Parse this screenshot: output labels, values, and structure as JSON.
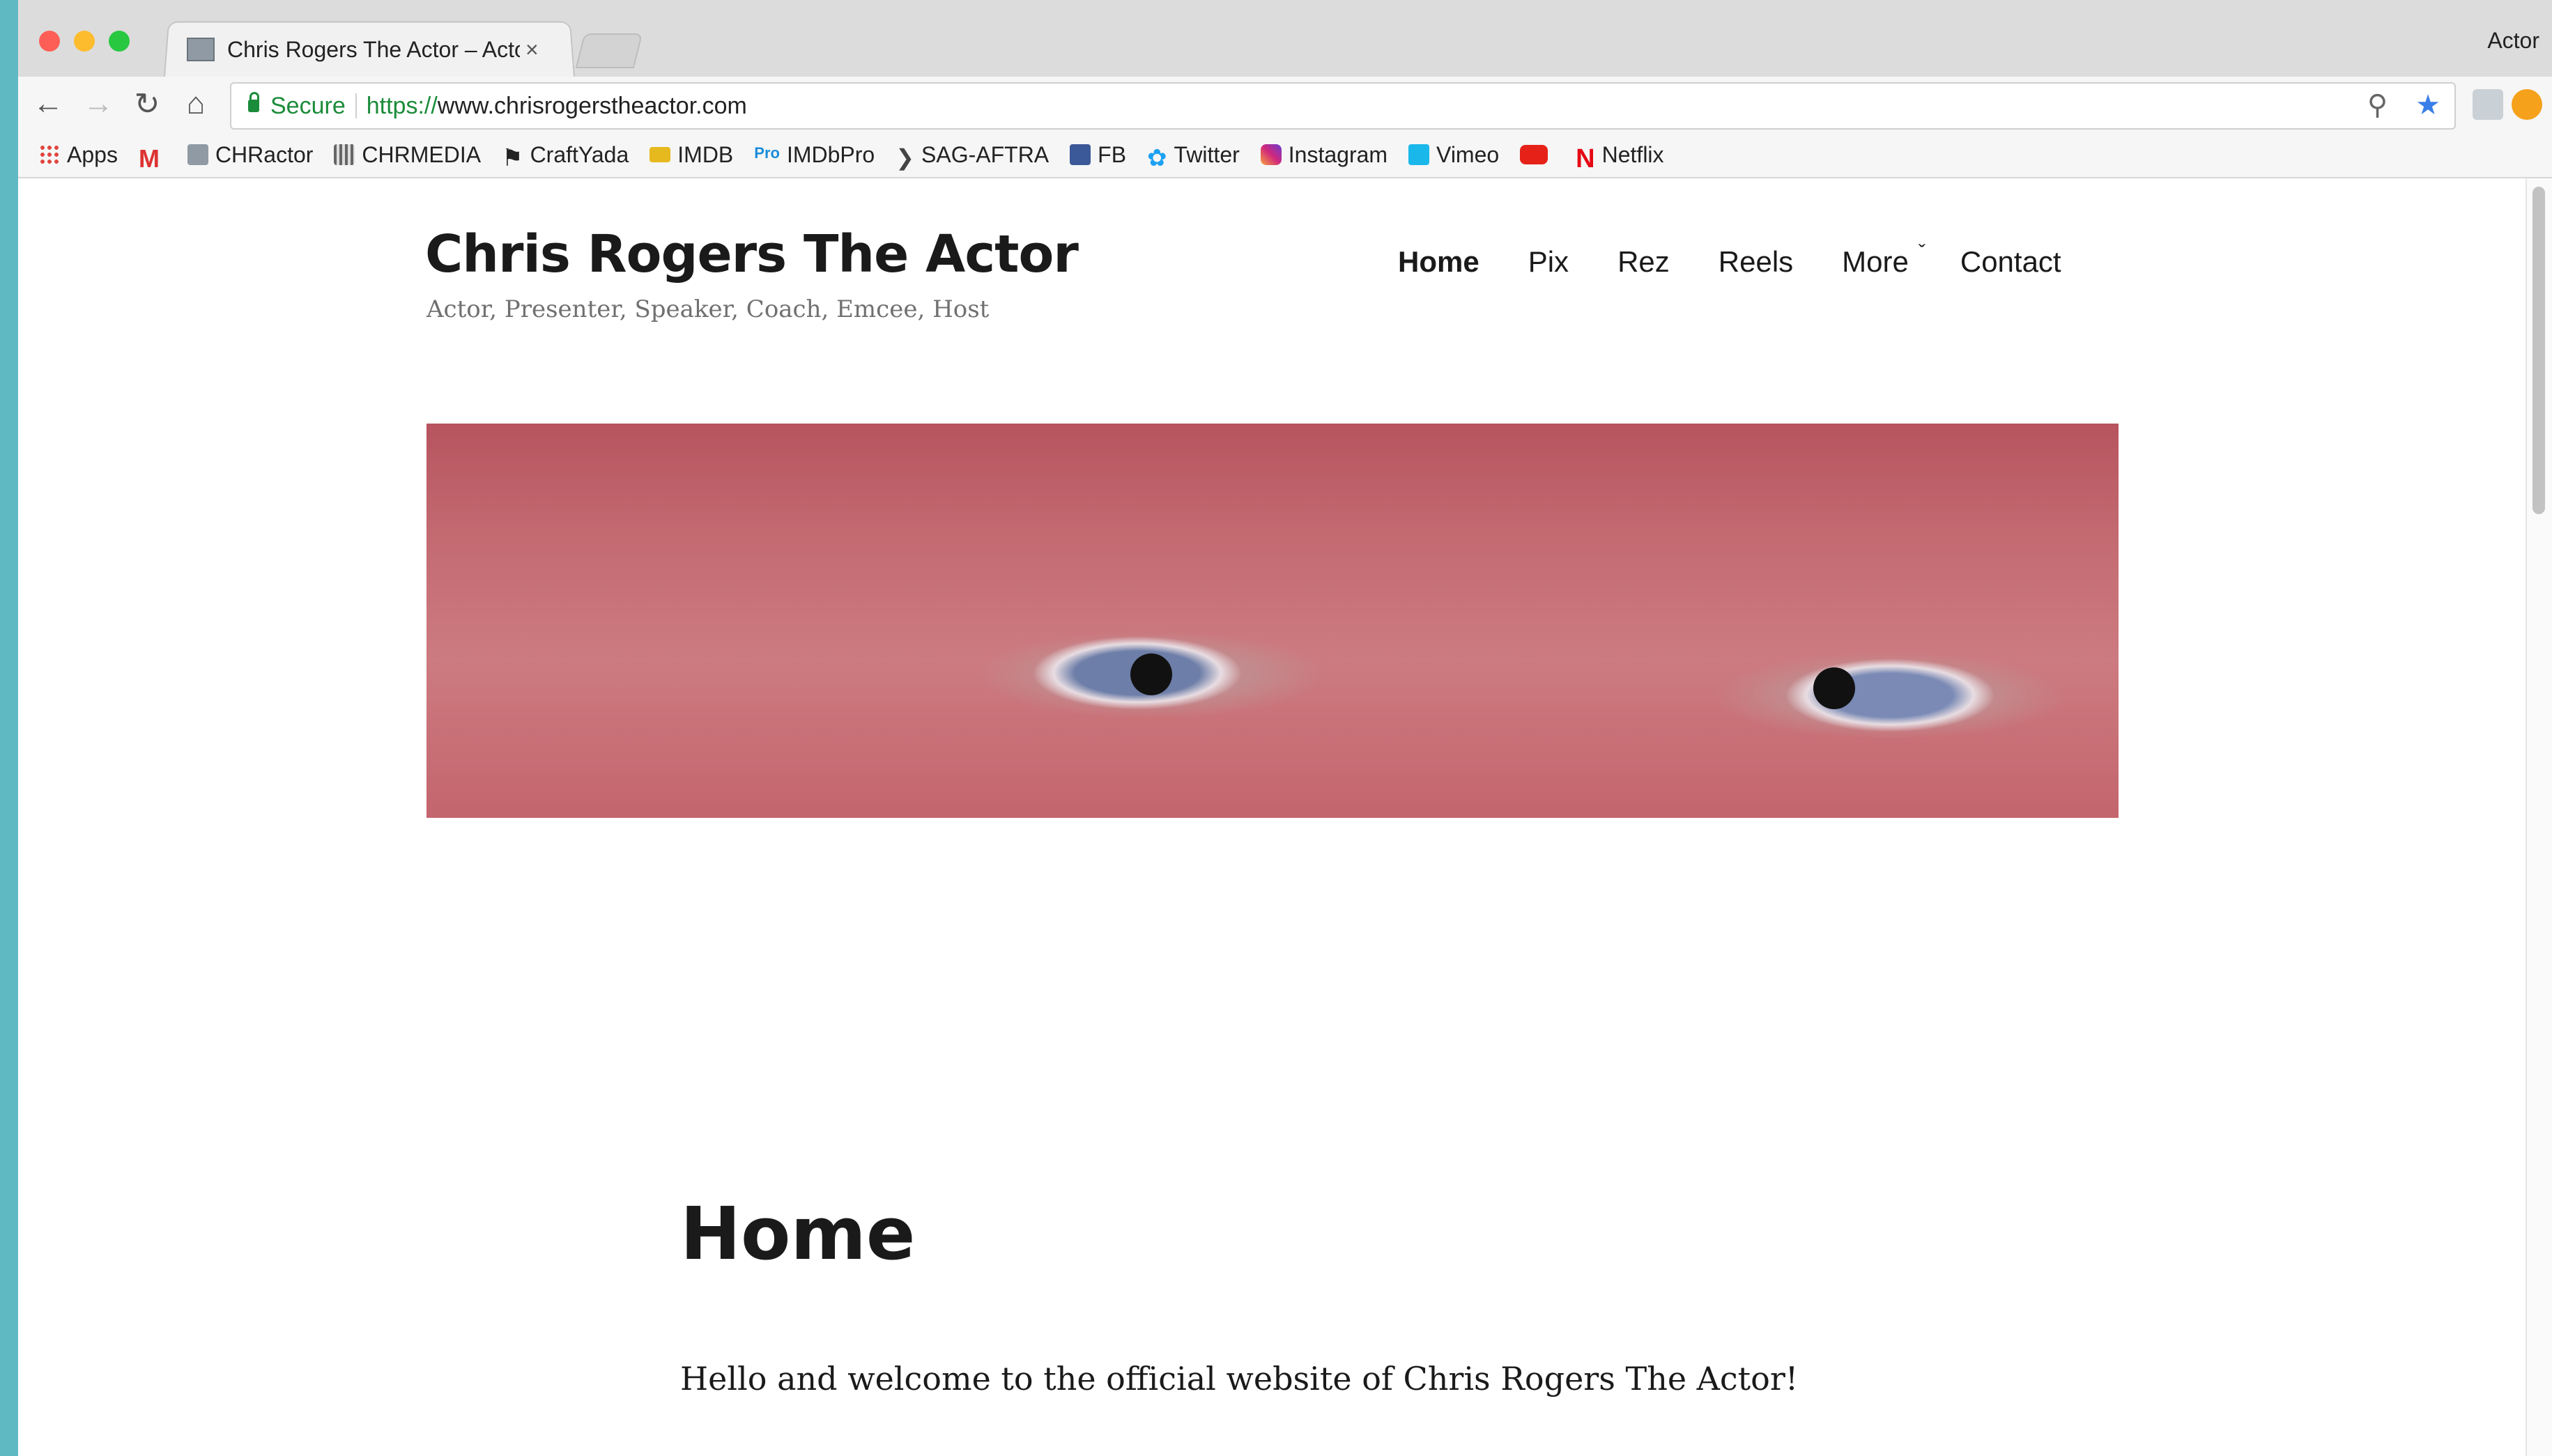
{
  "browser": {
    "tab_title": "Chris Rogers The Actor – Actor",
    "tab_close": "×",
    "profile_name": "Actor",
    "security_label": "Secure",
    "url_scheme": "https://",
    "url_rest": "www.chrisrogerstheactor.com",
    "icons": [
      "back-icon",
      "forward-icon",
      "reload-icon",
      "home-icon",
      "lock-icon",
      "zoom-icon",
      "star-icon",
      "download-extension-icon",
      "orange-extension-icon"
    ]
  },
  "bookmarks": [
    {
      "label": "Apps",
      "icon": "apps-icon"
    },
    {
      "label": "",
      "icon": "gmail-icon"
    },
    {
      "label": "CHRactor",
      "icon": "chractor-icon"
    },
    {
      "label": "CHRMEDIA",
      "icon": "chrmedia-icon"
    },
    {
      "label": "CraftYada",
      "icon": "trophy-icon"
    },
    {
      "label": "IMDB",
      "icon": "imdb-icon"
    },
    {
      "label": "IMDbPro",
      "icon": "imdbpro-icon"
    },
    {
      "label": "SAG-AFTRA",
      "icon": "sag-aftra-icon"
    },
    {
      "label": "FB",
      "icon": "facebook-icon"
    },
    {
      "label": "Twitter",
      "icon": "twitter-icon"
    },
    {
      "label": "Instagram",
      "icon": "instagram-icon"
    },
    {
      "label": "Vimeo",
      "icon": "vimeo-icon"
    },
    {
      "label": "",
      "icon": "youtube-icon"
    },
    {
      "label": "Netflix",
      "icon": "netflix-icon"
    }
  ],
  "site": {
    "title": "Chris Rogers The Actor",
    "description": "Actor, Presenter, Speaker, Coach, Emcee, Host",
    "nav": [
      "Home",
      "Pix",
      "Rez",
      "Reels",
      "More",
      "Contact"
    ],
    "nav_active": "Home"
  },
  "content": {
    "heading": "Home",
    "intro": "Hello and welcome to the official website of Chris Rogers The Actor!"
  }
}
